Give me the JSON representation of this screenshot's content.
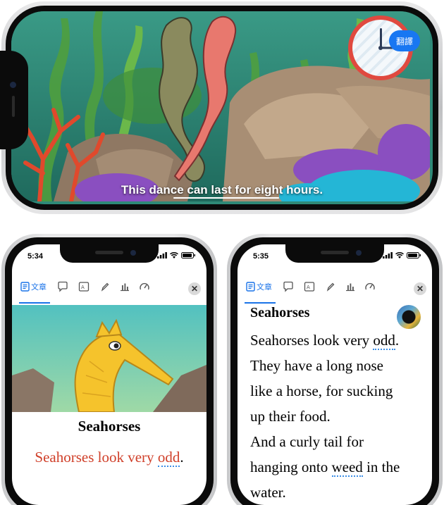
{
  "video": {
    "subtitle": "This dance can last for eight hours.",
    "translate_label": "翻譯"
  },
  "left_phone": {
    "time": "5:34",
    "tab_label": "文章",
    "title": "Seahorses",
    "sentence_pre": "Seahorses look very ",
    "sentence_hl": "odd",
    "sentence_post": ".",
    "sentence_color": "#d0402a"
  },
  "right_phone": {
    "time": "5:35",
    "tab_label": "文章",
    "title": "Seahorses",
    "lines": [
      {
        "pre": "Seahorses look very ",
        "hl": "odd",
        "post": "."
      },
      {
        "pre": "They have a long nose",
        "hl": "",
        "post": ""
      },
      {
        "pre": "like a horse, for sucking",
        "hl": "",
        "post": ""
      },
      {
        "pre": "up their food.",
        "hl": "",
        "post": ""
      },
      {
        "pre": "And a curly tail for",
        "hl": "",
        "post": ""
      },
      {
        "pre": "hanging onto ",
        "hl": "weed",
        "post": " in the"
      },
      {
        "pre": "water.",
        "hl": "",
        "post": ""
      }
    ]
  },
  "icons": [
    "article-icon",
    "comment-icon",
    "translate-box-icon",
    "pen-icon",
    "bar-chart-icon",
    "speedometer-icon",
    "close-icon",
    "clock-icon",
    "signal-icon",
    "wifi-icon",
    "battery-icon"
  ],
  "colors": {
    "accent": "#1a73e8",
    "highlight_underline": "#3b8ee6",
    "translate_button": "#1877f2",
    "clock_rim": "#e0493f"
  }
}
